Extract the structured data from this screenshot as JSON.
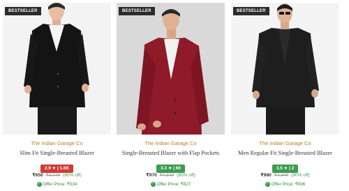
{
  "products": [
    {
      "badge": "BESTSELLER",
      "brand": "The Indian Garage Co",
      "title": "Slim Fit Single-Breasted Blazer",
      "rating": "2.9 ★ | 1.6K",
      "rating_color": "#d03b35",
      "price": "₹650",
      "mrp": "₹3,249",
      "discount": "(80% off)",
      "offer": "Offer Price: ₹534"
    },
    {
      "badge": "BESTSELLER",
      "brand": "The Indian Garage Co",
      "title": "Single-Breasted Blazer with Flap Pockets",
      "rating": "3.3 ★ | 66",
      "rating_color": "#3f9b4f",
      "price": "₹970",
      "mrp": "₹4,849",
      "discount": "(80% off)",
      "offer": "Offer Price: ₹827"
    },
    {
      "badge": "BESTSELLER",
      "brand": "The Indian Garage Co",
      "title": "Men Regular Fit Single-Breasted Blazer",
      "rating": "3.5 ★ | 2",
      "rating_color": "#3f9b4f",
      "price": "₹980",
      "mrp": "₹4,899",
      "discount": "(80% off)",
      "offer": "Offer Price: ₹836"
    }
  ],
  "colors": {
    "brand_text": "#c07a1a",
    "offer_text": "#2e8b3e",
    "badge_bg": "#2b2b2b"
  },
  "icons": [
    "check-circle-icon"
  ]
}
